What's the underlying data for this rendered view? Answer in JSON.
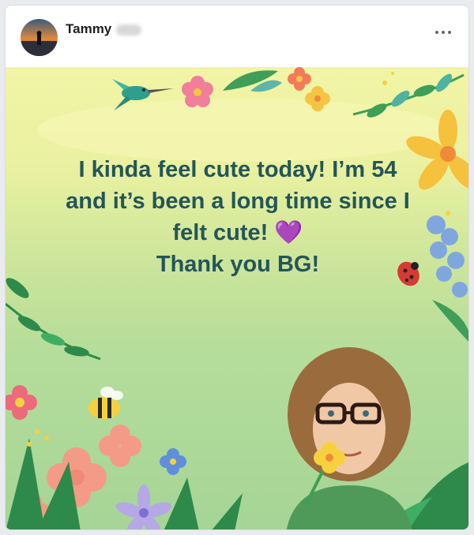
{
  "post": {
    "author_name": "Tammy",
    "text_line1": "I kinda feel cute today! I’m 54",
    "text_line2": "and it’s been a long time since I",
    "text_line3": "felt cute! 💜",
    "text_line4": "Thank you BG!"
  },
  "icons": {
    "more": "more-options-icon",
    "heart": "purple-heart-emoji"
  },
  "colors": {
    "text": "#245559",
    "background_top": "#f2f4a6",
    "background_bottom": "#a5d597"
  }
}
